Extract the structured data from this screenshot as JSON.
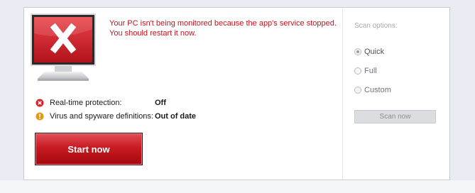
{
  "alert": {
    "message": "Your PC isn't being monitored because the app's service stopped. You should restart it now."
  },
  "status": [
    {
      "label": "Real-time protection:",
      "value": "Off",
      "icon": "error-x-icon"
    },
    {
      "label": "Virus and spyware definitions:",
      "value": "Out of date",
      "icon": "warning-exclamation-icon"
    }
  ],
  "actions": {
    "start_label": "Start now"
  },
  "scan_options": {
    "title": "Scan options:",
    "options": [
      {
        "label": "Quick",
        "selected": true
      },
      {
        "label": "Full",
        "selected": false
      },
      {
        "label": "Custom",
        "selected": false
      }
    ],
    "scan_label": "Scan now"
  },
  "colors": {
    "alert": "#c4121a",
    "button_red": "#c91a22"
  }
}
